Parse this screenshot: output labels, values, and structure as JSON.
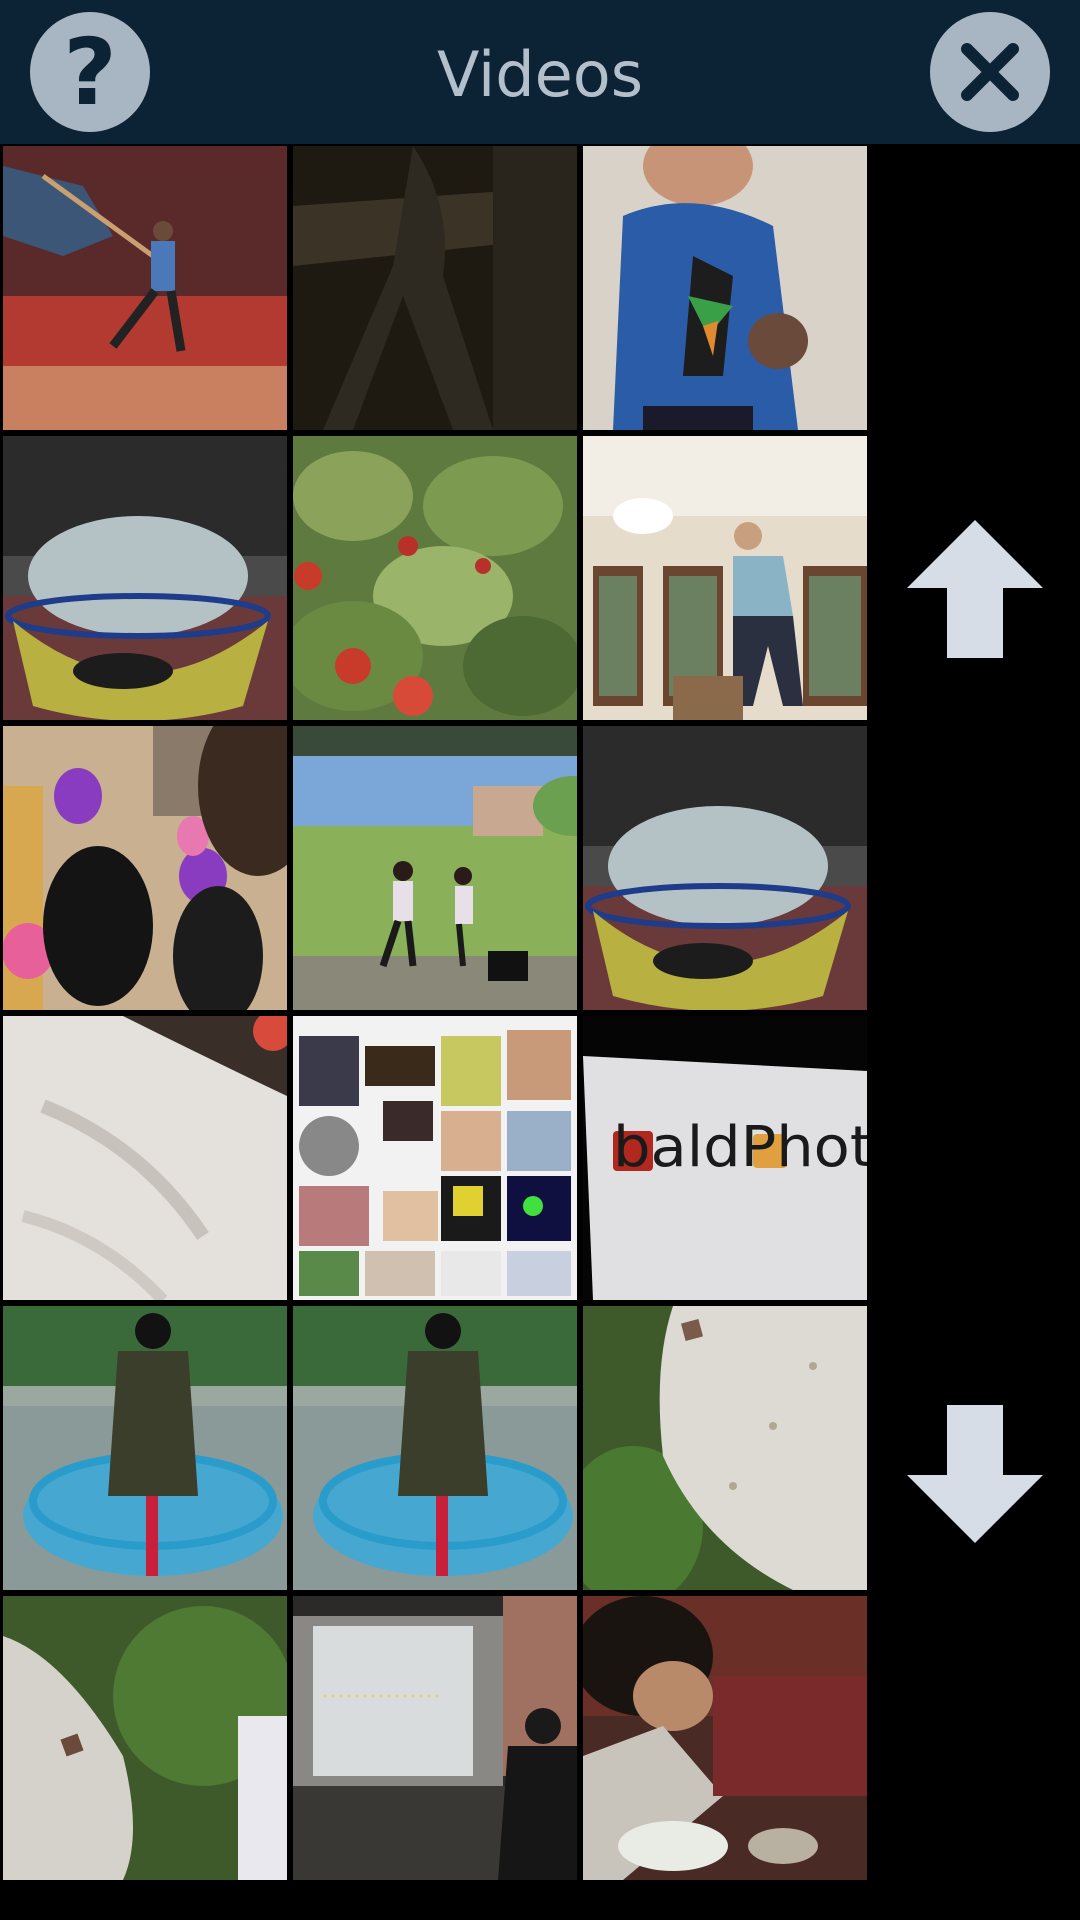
{
  "header": {
    "title": "Videos",
    "help_icon": "question-icon",
    "close_icon": "close-icon",
    "bg_color": "#0c2235",
    "button_color": "#a8b6c4"
  },
  "videos": [
    {
      "name": "video-flag-dancer"
    },
    {
      "name": "video-dark-street"
    },
    {
      "name": "video-boy-blue-shirt"
    },
    {
      "name": "video-bowl-outdoor"
    },
    {
      "name": "video-raspberry-bush"
    },
    {
      "name": "video-man-dining-room"
    },
    {
      "name": "video-balloon-party"
    },
    {
      "name": "video-stage-performance"
    },
    {
      "name": "video-bowl-outdoor-2"
    },
    {
      "name": "video-white-shirt-closeup"
    },
    {
      "name": "video-photo-collage"
    },
    {
      "name": "video-baldphoto-sign",
      "text": "baldPhot"
    },
    {
      "name": "video-carousel-rider"
    },
    {
      "name": "video-carousel-rider-2"
    },
    {
      "name": "video-granite-rock"
    },
    {
      "name": "video-granite-rock-2"
    },
    {
      "name": "video-projector-room"
    },
    {
      "name": "video-person-eating"
    }
  ],
  "scroll": {
    "up_icon": "arrow-up-icon",
    "down_icon": "arrow-down-icon",
    "color": "#d6dde6"
  }
}
